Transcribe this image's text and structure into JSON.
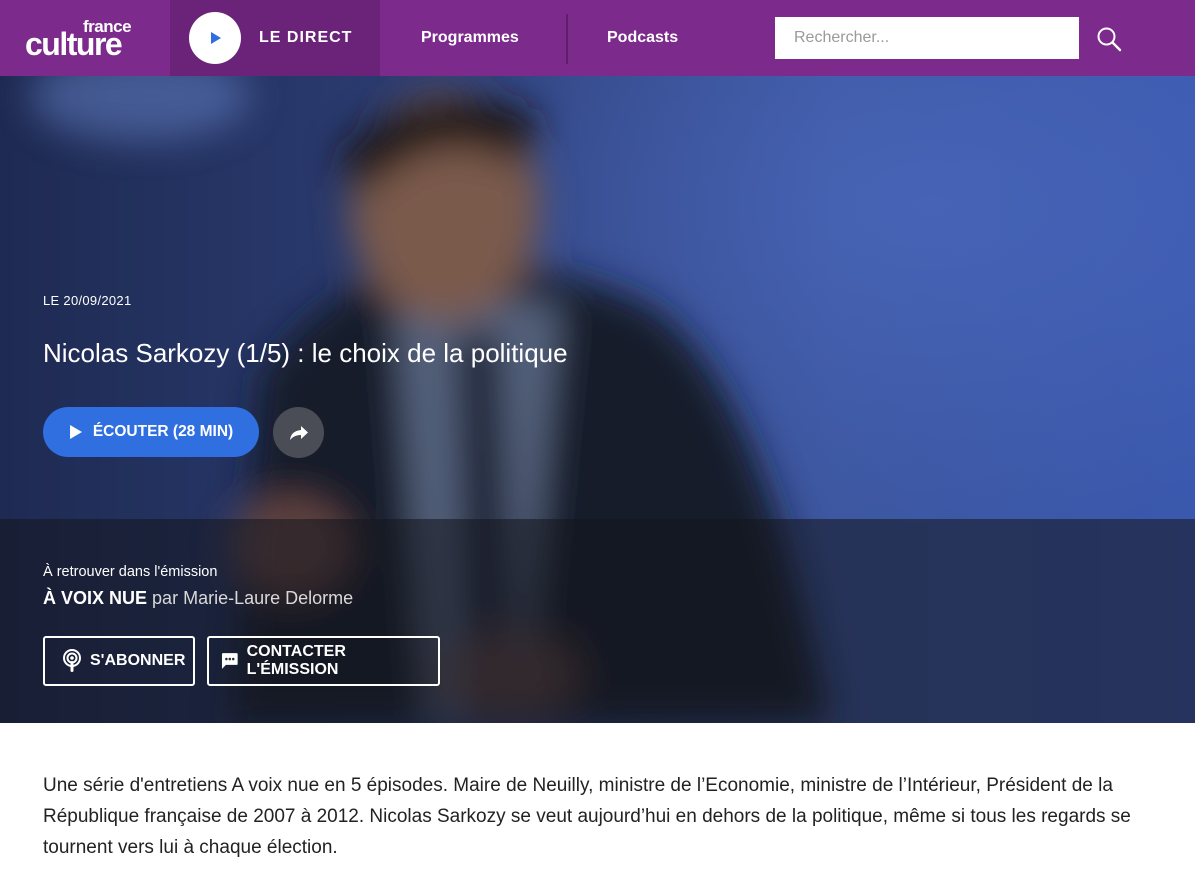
{
  "header": {
    "logo_small": "france",
    "logo_big": "culture",
    "direct_label": "LE DIRECT",
    "nav": [
      "Programmes",
      "Podcasts"
    ],
    "search_placeholder": "Rechercher..."
  },
  "episode": {
    "date": "LE 20/09/2021",
    "title": "Nicolas Sarkozy (1/5) : le choix de la politique",
    "listen_label": "ÉCOUTER (28 MIN)"
  },
  "program": {
    "retrouver": "À retrouver dans l'émission",
    "name": "À VOIX NUE",
    "par": "par",
    "author": "Marie-Laure Delorme",
    "subscribe_label": "S'ABONNER",
    "contact_label": "CONTACTER L'ÉMISSION"
  },
  "description": "Une série d'entretiens A voix nue en 5 épisodes. Maire de Neuilly, ministre de l’Economie, ministre de l’Intérieur, Président de la République française de 2007 à 2012. Nicolas Sarkozy se veut aujourd’hui en dehors de la politique, même si tous les regards se tournent vers lui à chaque élection.",
  "colors": {
    "header_bg": "#7c2a8c",
    "direct_bg": "#6a2378",
    "play_accent": "#2f6fe0"
  },
  "icons": {
    "direct_play": "play-icon",
    "search": "search-icon",
    "listen_play": "play-icon",
    "share": "share-icon",
    "subscribe": "podcast-icon",
    "contact": "chat-icon"
  }
}
